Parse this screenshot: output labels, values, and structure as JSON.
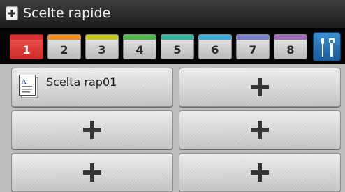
{
  "header": {
    "title": "Scelte rapide",
    "icon": "shortcut-add-icon"
  },
  "tabs": [
    {
      "label": "1",
      "color": "#d7322f",
      "active": true
    },
    {
      "label": "2",
      "color": "#f28f1c",
      "active": false
    },
    {
      "label": "3",
      "color": "#c6c91e",
      "active": false
    },
    {
      "label": "4",
      "color": "#4db848",
      "active": false
    },
    {
      "label": "5",
      "color": "#2fb39b",
      "active": false
    },
    {
      "label": "6",
      "color": "#36a9d6",
      "active": false
    },
    {
      "label": "7",
      "color": "#7a7fc8",
      "active": false
    },
    {
      "label": "8",
      "color": "#a06bb5",
      "active": false
    }
  ],
  "tools_button": {
    "icon": "tools-icon"
  },
  "shortcuts": [
    {
      "label": "Scelta rap01",
      "icon": "document-icon"
    },
    {
      "label": "",
      "icon": "plus-icon"
    },
    {
      "label": "",
      "icon": "plus-icon"
    },
    {
      "label": "",
      "icon": "plus-icon"
    },
    {
      "label": "",
      "icon": "plus-icon"
    },
    {
      "label": "",
      "icon": "plus-icon"
    }
  ]
}
